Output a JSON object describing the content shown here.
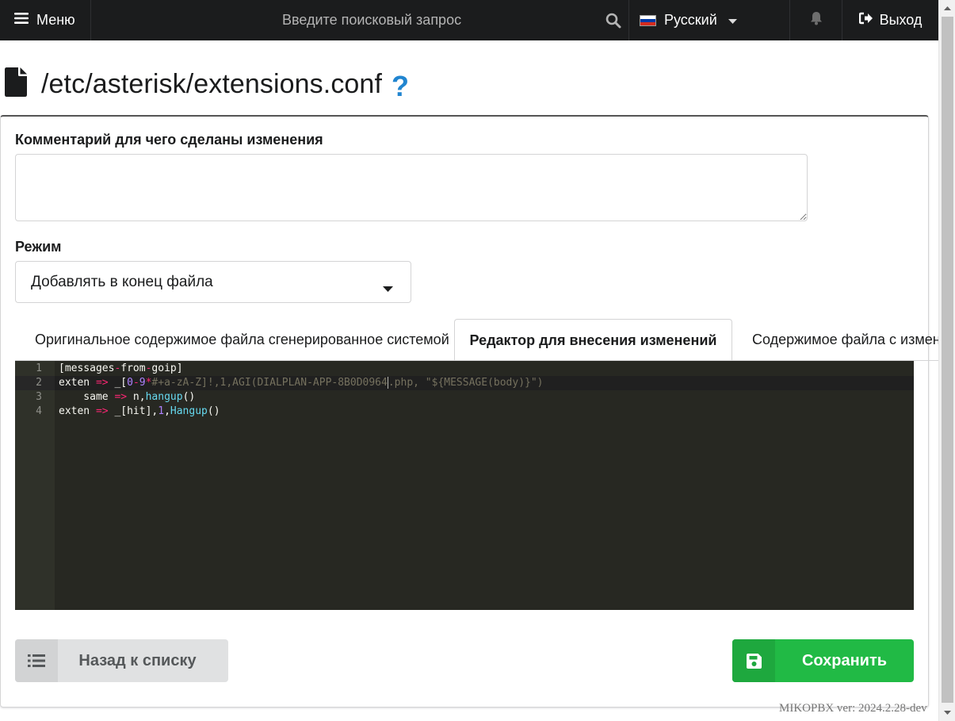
{
  "topbar": {
    "menu_label": "Меню",
    "search_placeholder": "Введите поисковый запрос",
    "language": "Русский",
    "logout_label": "Выход"
  },
  "page": {
    "title": "/etc/asterisk/extensions.conf",
    "help_glyph": "?"
  },
  "form": {
    "comment_label": "Комментарий для чего сделаны изменения",
    "comment_value": "",
    "mode_label": "Режим",
    "mode_value": "Добавлять в конец файла"
  },
  "tabs": [
    {
      "label": "Оригинальное содержимое файла сгенерированное системой",
      "active": false
    },
    {
      "label": "Редактор для внесения изменений",
      "active": true
    },
    {
      "label": "Содержимое файла с изменениями",
      "active": false
    }
  ],
  "editor": {
    "line_numbers": [
      "1",
      "2",
      "3",
      "4"
    ],
    "lines": [
      "[messages-from-goip]",
      "exten => _[0-9*#+a-zA-Z]!,1,AGI(DIALPLAN-APP-8B0D0964.php, \"${MESSAGE(body)}\")",
      "    same => n,hangup()",
      "exten => _[hit],1,Hangup()"
    ],
    "active_line": 2,
    "theme_bg": "#272822"
  },
  "buttons": {
    "back_label": "Назад к списку",
    "save_label": "Сохранить"
  },
  "footer": {
    "version": "MIKOPBX ver: 2024.2.28-dev"
  },
  "colors": {
    "topbar_bg": "#1b1c1d",
    "help_icon": "#2185d0",
    "save_button": "#21ba45",
    "back_button": "#e0e1e2"
  },
  "icons": [
    "bars-icon",
    "search-icon",
    "ru-flag-icon",
    "caret-down-icon",
    "bell-icon",
    "sign-out-icon",
    "file-icon",
    "help-icon",
    "list-icon",
    "save-icon"
  ]
}
